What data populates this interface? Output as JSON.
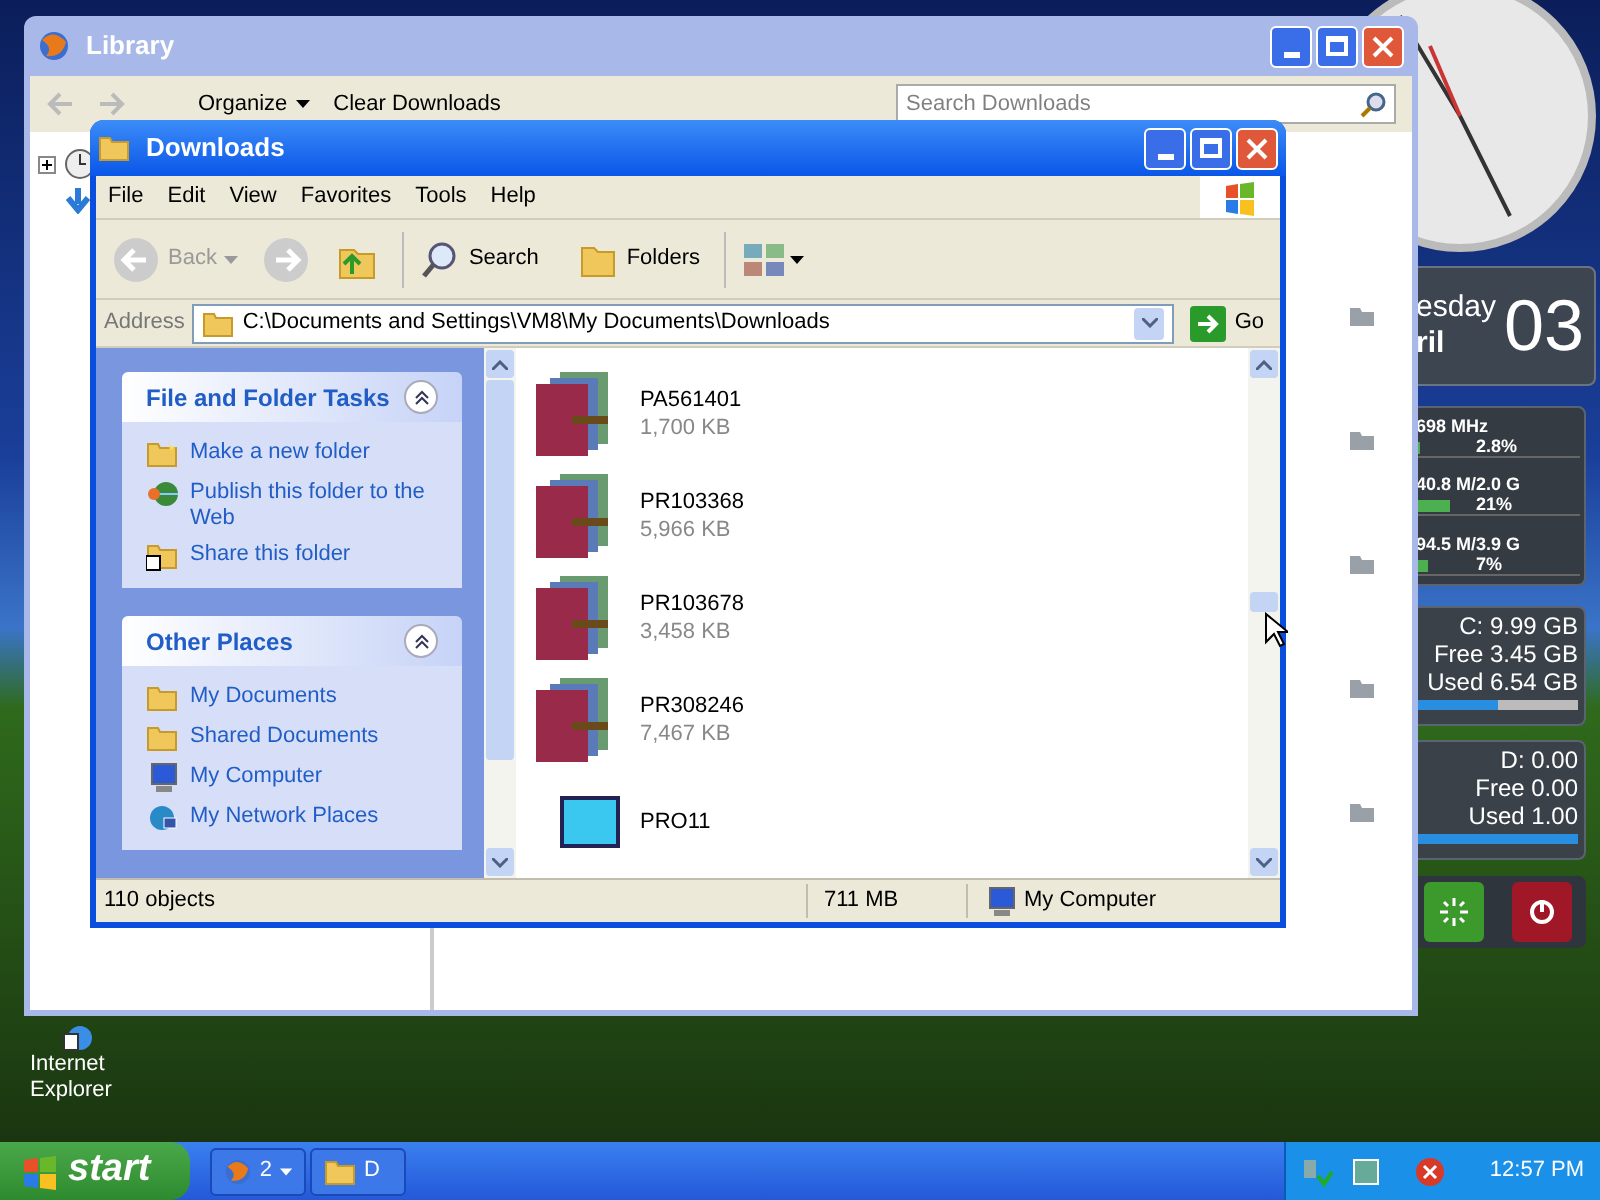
{
  "library_window": {
    "title": "Library",
    "toolbar": {
      "organize": "Organize",
      "clear": "Clear Downloads"
    },
    "search": {
      "placeholder": "Search Downloads"
    }
  },
  "downloads_window": {
    "title": "Downloads",
    "menu": [
      "File",
      "Edit",
      "View",
      "Favorites",
      "Tools",
      "Help"
    ],
    "toolbar": {
      "back": "Back",
      "search": "Search",
      "folders": "Folders"
    },
    "address": {
      "label": "Address",
      "value": "C:\\Documents and Settings\\VM8\\My Documents\\Downloads",
      "go": "Go"
    },
    "panels": [
      {
        "title": "File and Folder Tasks",
        "expanded": true,
        "items": [
          {
            "label": "Make a new folder",
            "kind": "newfolder"
          },
          {
            "label": "Publish this folder to the Web",
            "kind": "web"
          },
          {
            "label": "Share this folder",
            "kind": "share"
          }
        ]
      },
      {
        "title": "Other Places",
        "expanded": true,
        "items": [
          {
            "label": "My Documents",
            "kind": "folder"
          },
          {
            "label": "Shared Documents",
            "kind": "folder"
          },
          {
            "label": "My Computer",
            "kind": "computer"
          },
          {
            "label": "My Network Places",
            "kind": "network"
          }
        ]
      }
    ],
    "files": [
      {
        "name": "PA561401",
        "size": "1,700 KB",
        "kind": "archive"
      },
      {
        "name": "PR103368",
        "size": "5,966 KB",
        "kind": "archive"
      },
      {
        "name": "PR103678",
        "size": "3,458 KB",
        "kind": "archive"
      },
      {
        "name": "PR308246",
        "size": "7,467 KB",
        "kind": "archive"
      },
      {
        "name": "PRO11",
        "kind": "program"
      }
    ],
    "status_bar": {
      "objects": "110 objects",
      "size": "711 MB",
      "zone": "My Computer"
    }
  },
  "gadgets": {
    "date": {
      "weekday": "esday",
      "month": "ril",
      "day": "03"
    },
    "meters": [
      {
        "reading": "698 MHz",
        "percent": "2.8%",
        "level": 0.028
      },
      {
        "reading": "40.8 M/2.0 G",
        "percent": "21%",
        "level": 0.21
      },
      {
        "reading": "94.5 M/3.9 G",
        "percent": "7%",
        "level": 0.07
      }
    ],
    "drives": [
      {
        "name": "C:  9.99 GB",
        "free": "Free 3.45 GB",
        "used": "Used 6.54 GB",
        "level": 0.5
      },
      {
        "name": "D:  0.00",
        "free": "Free 0.00",
        "used": "Used 1.00",
        "level": 1
      }
    ]
  },
  "desktop_icons": [
    {
      "label": "Internet Explorer"
    }
  ],
  "taskbar": {
    "start": "start",
    "tasks": [
      {
        "label": "2",
        "kind": "firefox"
      },
      {
        "label": "D",
        "kind": "folder"
      }
    ],
    "clock": "12:57 PM"
  }
}
